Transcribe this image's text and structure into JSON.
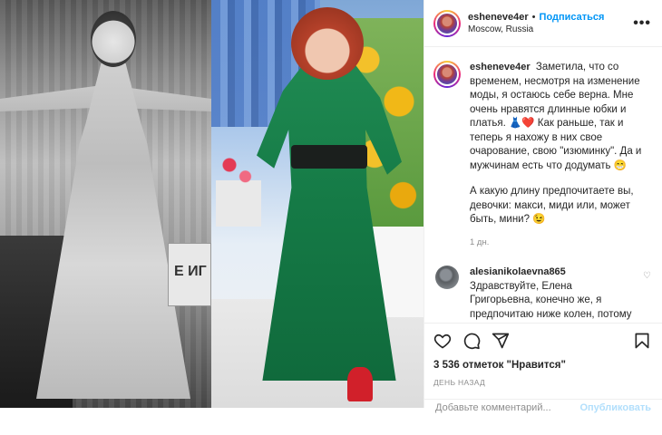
{
  "post": {
    "left_photo_sign": "Е ИГ",
    "header": {
      "username": "esheneve4er",
      "separator": "•",
      "follow_label": "Подписаться",
      "location": "Moscow, Russia",
      "more_icon": "•••"
    },
    "caption": {
      "username": "esheneve4er",
      "paragraph1": "Заметила, что со временем, несмотря на изменение моды, я остаюсь себе верна. Мне очень нравятся длинные юбки и платья. 👗❤️ Как раньше, так и теперь я нахожу в них свое очарование, свою \"изюминку\". Да и мужчинам есть что додумать 😁",
      "paragraph2": "А какую длину предпочитаете вы, девочки: макси, миди или, может быть, мини? 😉",
      "time": "1 дн."
    },
    "comment": {
      "username": "alesianikolaevna865",
      "text": "Здравствуйте, Елена Григорьевна, конечно же, я предпочитаю ниже колен, потому что мне именно такая",
      "heart_icon": "♡"
    },
    "actions": {
      "like_icon": "heart-icon",
      "comment_icon": "comment-icon",
      "share_icon": "share-icon",
      "save_icon": "bookmark-icon"
    },
    "likes": "3 536 отметок \"Нравится\"",
    "date": "ДЕНЬ НАЗАД",
    "add_comment": {
      "placeholder": "Добавьте комментарий...",
      "publish_label": "Опубликовать"
    }
  },
  "colors": {
    "link": "#0095f6",
    "text": "#262626",
    "muted": "#8e8e8e"
  }
}
